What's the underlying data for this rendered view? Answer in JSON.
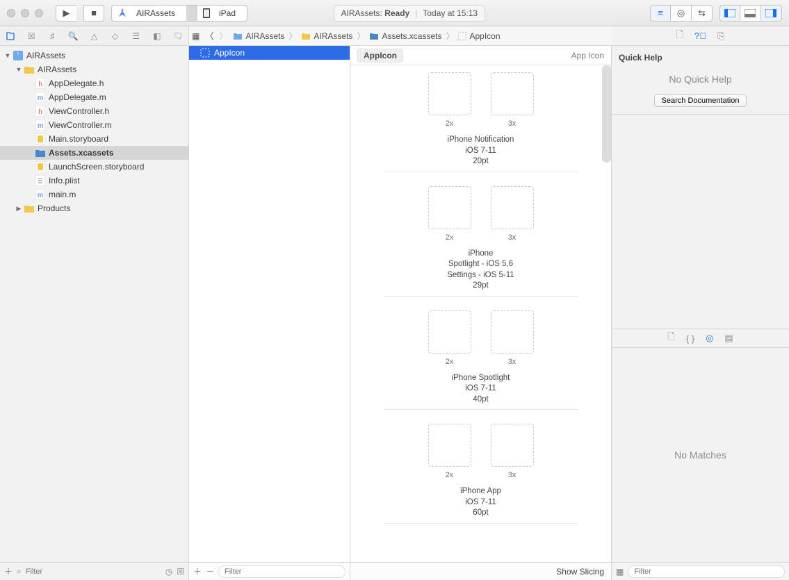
{
  "titlebar": {
    "scheme_target": "AIRAssets",
    "scheme_device": "iPad",
    "status_project": "AIRAssets",
    "status_state": "Ready",
    "status_time": "Today at 15:13"
  },
  "navigator": {
    "tree": [
      {
        "label": "AIRAssets",
        "indent": 0,
        "kind": "project",
        "expanded": true
      },
      {
        "label": "AIRAssets",
        "indent": 1,
        "kind": "folder",
        "expanded": true
      },
      {
        "label": "AppDelegate.h",
        "indent": 2,
        "kind": "h"
      },
      {
        "label": "AppDelegate.m",
        "indent": 2,
        "kind": "m"
      },
      {
        "label": "ViewController.h",
        "indent": 2,
        "kind": "h"
      },
      {
        "label": "ViewController.m",
        "indent": 2,
        "kind": "m"
      },
      {
        "label": "Main.storyboard",
        "indent": 2,
        "kind": "storyboard"
      },
      {
        "label": "Assets.xcassets",
        "indent": 2,
        "kind": "xcassets",
        "selected": true
      },
      {
        "label": "LaunchScreen.storyboard",
        "indent": 2,
        "kind": "storyboard"
      },
      {
        "label": "Info.plist",
        "indent": 2,
        "kind": "plist"
      },
      {
        "label": "main.m",
        "indent": 2,
        "kind": "m"
      },
      {
        "label": "Products",
        "indent": 1,
        "kind": "folder",
        "expanded": false
      }
    ],
    "filter_placeholder": "Filter"
  },
  "jumpbar": [
    "AIRAssets",
    "AIRAssets",
    "Assets.xcassets",
    "AppIcon"
  ],
  "asset_list": {
    "items": [
      "AppIcon"
    ],
    "selected": 0,
    "filter_placeholder": "Filter"
  },
  "editor": {
    "title": "AppIcon",
    "subtitle": "App Icon",
    "show_slicing": "Show Slicing",
    "groups": [
      {
        "caption": [
          "iPhone Notification",
          "iOS 7-11",
          "20pt"
        ],
        "slots": [
          "2x",
          "3x"
        ]
      },
      {
        "caption": [
          "iPhone",
          "Spotlight - iOS 5,6",
          "Settings - iOS 5-11",
          "29pt"
        ],
        "slots": [
          "2x",
          "3x"
        ]
      },
      {
        "caption": [
          "iPhone Spotlight",
          "iOS 7-11",
          "40pt"
        ],
        "slots": [
          "2x",
          "3x"
        ]
      },
      {
        "caption": [
          "iPhone App",
          "iOS 7-11",
          "60pt"
        ],
        "slots": [
          "2x",
          "3x"
        ]
      }
    ]
  },
  "inspector": {
    "quick_help_title": "Quick Help",
    "no_quick_help": "No Quick Help",
    "search_doc": "Search Documentation",
    "no_matches": "No Matches",
    "filter_placeholder": "Filter"
  }
}
